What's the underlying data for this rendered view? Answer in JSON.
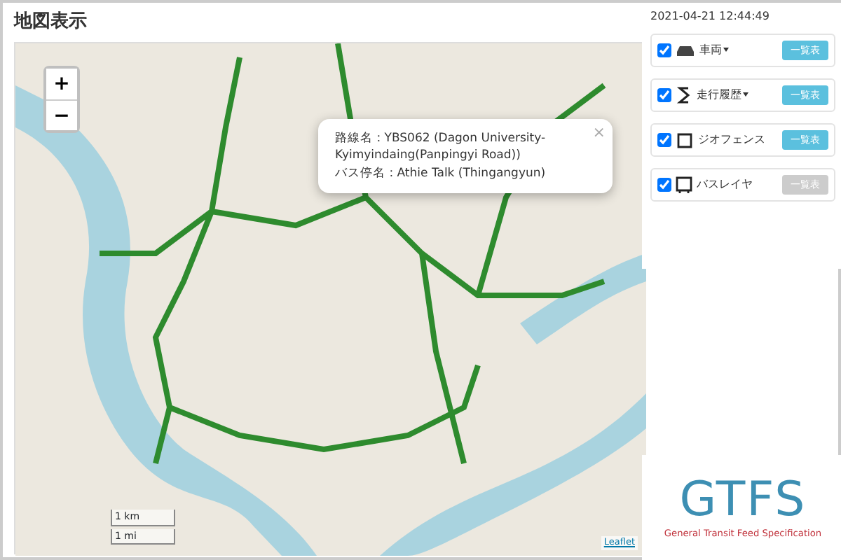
{
  "page_title": "地図表示",
  "map": {
    "zoom_in": "+",
    "zoom_out": "−",
    "popup": {
      "lines": [
        "路線名 : YBS062 (Dagon University-Kyimyindaing(Panpingyi Road))",
        "バス停名 : Athie Talk (Thingangyun)"
      ],
      "close": "×"
    },
    "scale": [
      "1 km",
      "1 mi"
    ],
    "attribution": "Leaflet"
  },
  "panel": {
    "timestamp": "2021-04-21 12:44:49",
    "layers": [
      {
        "kind": "car",
        "label": "車両",
        "checked": true,
        "dropdown": true,
        "button": {
          "label": "一覧表",
          "disabled": false
        }
      },
      {
        "kind": "route",
        "label": "走行履歴",
        "checked": true,
        "dropdown": true,
        "button": {
          "label": "一覧表",
          "disabled": false
        }
      },
      {
        "kind": "geofence",
        "label": "ジオフェンス",
        "checked": true,
        "dropdown": false,
        "button": {
          "label": "一覧表",
          "disabled": false
        }
      },
      {
        "kind": "bus",
        "label": "バスレイヤ",
        "checked": true,
        "dropdown": false,
        "button": {
          "label": "一覧表",
          "disabled": true
        }
      }
    ]
  },
  "logo": {
    "wordmark": "GTFS",
    "tagline": "General Transit Feed Specification"
  }
}
